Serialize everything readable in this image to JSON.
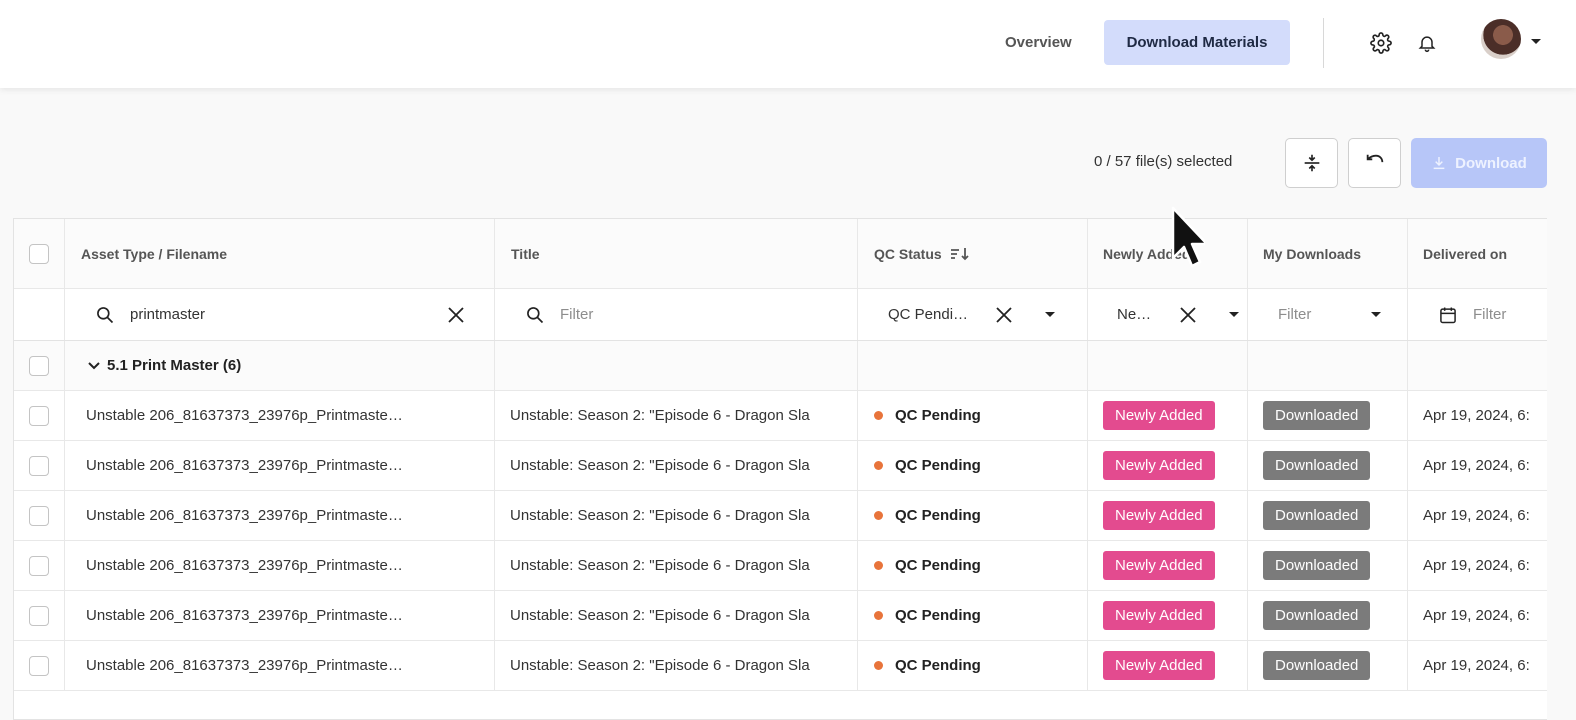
{
  "nav": {
    "overview": "Overview",
    "download_materials": "Download Materials"
  },
  "toolbar": {
    "selected": "0 / 57 file(s) selected",
    "download": "Download"
  },
  "columns": {
    "asset": "Asset Type / Filename",
    "title": "Title",
    "qc": "QC Status",
    "newly": "Newly Added",
    "mydl": "My Downloads",
    "delivered": "Delivered on"
  },
  "filters": {
    "asset_value": "printmaster",
    "title_placeholder": "Filter",
    "qc_value": "QC Pendi…",
    "newly_value": "Ne…",
    "mydl_placeholder": "Filter",
    "delivered_placeholder": "Filter"
  },
  "group": {
    "label": "5.1 Print Master (6)"
  },
  "rows": [
    {
      "filename": "Unstable 206_81637373_23976p_Printmaste…",
      "title": "Unstable: Season 2: \"Episode 6 - Dragon Sla",
      "qc": "QC Pending",
      "newly": "Newly Added",
      "mydl": "Downloaded",
      "delivered": "Apr 19, 2024, 6:"
    },
    {
      "filename": "Unstable 206_81637373_23976p_Printmaste…",
      "title": "Unstable: Season 2: \"Episode 6 - Dragon Sla",
      "qc": "QC Pending",
      "newly": "Newly Added",
      "mydl": "Downloaded",
      "delivered": "Apr 19, 2024, 6:"
    },
    {
      "filename": "Unstable 206_81637373_23976p_Printmaste…",
      "title": "Unstable: Season 2: \"Episode 6 - Dragon Sla",
      "qc": "QC Pending",
      "newly": "Newly Added",
      "mydl": "Downloaded",
      "delivered": "Apr 19, 2024, 6:"
    },
    {
      "filename": "Unstable 206_81637373_23976p_Printmaste…",
      "title": "Unstable: Season 2: \"Episode 6 - Dragon Sla",
      "qc": "QC Pending",
      "newly": "Newly Added",
      "mydl": "Downloaded",
      "delivered": "Apr 19, 2024, 6:"
    },
    {
      "filename": "Unstable 206_81637373_23976p_Printmaste…",
      "title": "Unstable: Season 2: \"Episode 6 - Dragon Sla",
      "qc": "QC Pending",
      "newly": "Newly Added",
      "mydl": "Downloaded",
      "delivered": "Apr 19, 2024, 6:"
    },
    {
      "filename": "Unstable 206_81637373_23976p_Printmaste…",
      "title": "Unstable: Season 2: \"Episode 6 - Dragon Sla",
      "qc": "QC Pending",
      "newly": "Newly Added",
      "mydl": "Downloaded",
      "delivered": "Apr 19, 2024, 6:"
    }
  ],
  "colors": {
    "nav_active_bg": "#d3dcfb",
    "download_btn_bg": "#b7c6f8",
    "status_dot": "#e8743b",
    "badge_newly": "#e34b8f",
    "badge_downloaded": "#7b7b7b"
  },
  "icons": {
    "settings": "gear-icon",
    "notifications": "bell-icon",
    "account_menu": "caret-down-icon",
    "collapse_rows": "split-icon",
    "undo": "undo-icon",
    "download": "download-icon",
    "search": "search-icon",
    "clear": "close-icon",
    "dropdown": "caret-down-icon",
    "calendar": "calendar-icon",
    "sort": "sort-icon",
    "group_toggle": "chevron-down-icon"
  }
}
